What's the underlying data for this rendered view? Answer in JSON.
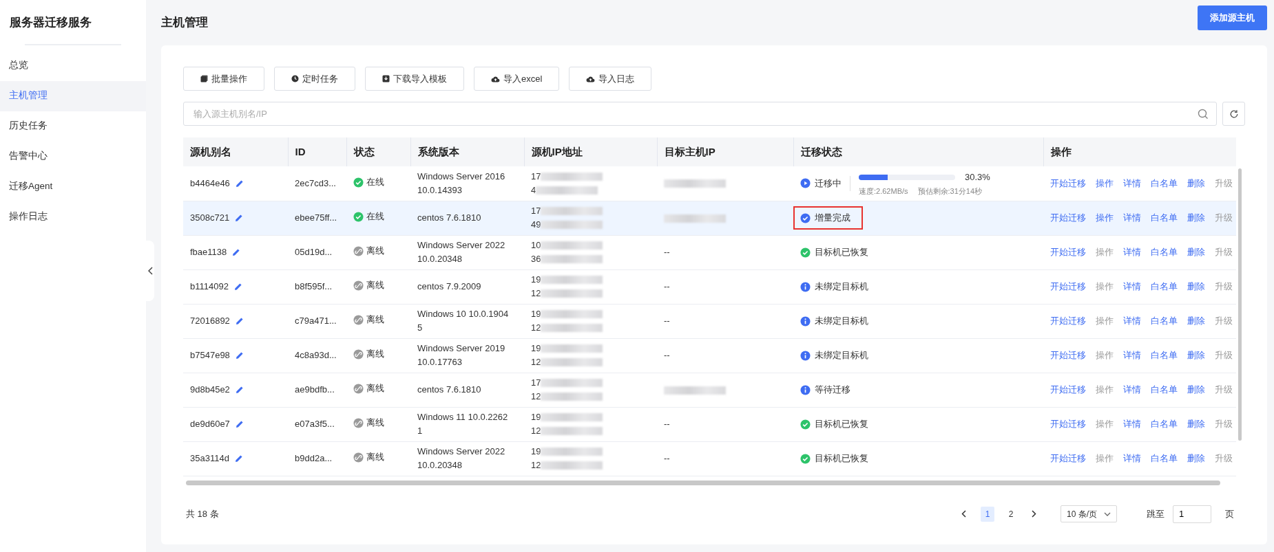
{
  "sidebar": {
    "title": "服务器迁移服务",
    "items": [
      {
        "label": "总览",
        "selected": false
      },
      {
        "label": "主机管理",
        "selected": true
      },
      {
        "label": "历史任务",
        "selected": false
      },
      {
        "label": "告警中心",
        "selected": false
      },
      {
        "label": "迁移Agent",
        "selected": false
      },
      {
        "label": "操作日志",
        "selected": false
      }
    ]
  },
  "header": {
    "title": "主机管理",
    "add_button": "添加源主机"
  },
  "toolbar": [
    {
      "label": "批量操作",
      "kind": "batch"
    },
    {
      "label": "定时任务",
      "kind": "schedule"
    },
    {
      "label": "下载导入模板",
      "kind": "download"
    },
    {
      "label": "导入excel",
      "kind": "import"
    },
    {
      "label": "导入日志",
      "kind": "import"
    }
  ],
  "search": {
    "placeholder": "输入源主机别名/IP"
  },
  "table": {
    "columns": [
      "源机别名",
      "ID",
      "状态",
      "系统版本",
      "源机IP地址",
      "目标主机IP",
      "迁移状态",
      "操作"
    ],
    "rows": [
      {
        "selected": false,
        "alias": "b4464e46",
        "id": "2ec7cd3...",
        "status": {
          "kind": "online",
          "label": "在线"
        },
        "os": [
          "Windows Server 2016",
          "10.0.14393"
        ],
        "source_ip": [
          "17",
          "4"
        ],
        "target_ip": {
          "kind": "redacted"
        },
        "migration": {
          "kind": "running",
          "label": "迁移中",
          "highlighted": false,
          "level": 0.303,
          "percent": "30.3%",
          "speed": "速度:2.62MB/s",
          "remaining": "预估剩余:31分14秒"
        },
        "actions": [
          {
            "label": "开始迁移",
            "disabled": false
          },
          {
            "label": "操作",
            "disabled": false
          },
          {
            "label": "详情",
            "disabled": false
          },
          {
            "label": "白名单",
            "disabled": false
          },
          {
            "label": "删除",
            "disabled": false
          },
          {
            "label": "升级",
            "disabled": true
          }
        ]
      },
      {
        "selected": true,
        "alias": "3508c721",
        "id": "ebee75ff...",
        "status": {
          "kind": "online",
          "label": "在线"
        },
        "os": [
          "centos 7.6.1810"
        ],
        "source_ip": [
          "17",
          "49"
        ],
        "target_ip": {
          "kind": "redacted"
        },
        "migration": {
          "kind": "completed",
          "label": "增量完成",
          "highlighted": true
        },
        "actions": [
          {
            "label": "开始迁移",
            "disabled": false
          },
          {
            "label": "操作",
            "disabled": false
          },
          {
            "label": "详情",
            "disabled": false
          },
          {
            "label": "白名单",
            "disabled": false
          },
          {
            "label": "删除",
            "disabled": false
          },
          {
            "label": "升级",
            "disabled": true
          }
        ]
      },
      {
        "selected": false,
        "alias": "fbae1138",
        "id": "05d19d...",
        "status": {
          "kind": "offline",
          "label": "离线"
        },
        "os": [
          "Windows Server 2022",
          "10.0.20348"
        ],
        "source_ip": [
          "10",
          "36"
        ],
        "target_ip": {
          "kind": "text",
          "text": "--"
        },
        "migration": {
          "kind": "restored",
          "label": "目标机已恢复",
          "highlighted": false
        },
        "actions": [
          {
            "label": "开始迁移",
            "disabled": false
          },
          {
            "label": "操作",
            "disabled": true
          },
          {
            "label": "详情",
            "disabled": false
          },
          {
            "label": "白名单",
            "disabled": false
          },
          {
            "label": "删除",
            "disabled": false
          },
          {
            "label": "升级",
            "disabled": true
          }
        ]
      },
      {
        "selected": false,
        "alias": "b1114092",
        "id": "b8f595f...",
        "status": {
          "kind": "offline",
          "label": "离线"
        },
        "os": [
          "centos 7.9.2009"
        ],
        "source_ip": [
          "19",
          "12"
        ],
        "target_ip": {
          "kind": "text",
          "text": "--"
        },
        "migration": {
          "kind": "pending",
          "label": "未绑定目标机",
          "highlighted": false
        },
        "actions": [
          {
            "label": "开始迁移",
            "disabled": false
          },
          {
            "label": "操作",
            "disabled": true
          },
          {
            "label": "详情",
            "disabled": false
          },
          {
            "label": "白名单",
            "disabled": false
          },
          {
            "label": "删除",
            "disabled": false
          },
          {
            "label": "升级",
            "disabled": true
          }
        ]
      },
      {
        "selected": false,
        "alias": "72016892",
        "id": "c79a471...",
        "status": {
          "kind": "offline",
          "label": "离线"
        },
        "os": [
          "Windows 10 10.0.1904",
          "5"
        ],
        "source_ip": [
          "19",
          "12"
        ],
        "target_ip": {
          "kind": "text",
          "text": "--"
        },
        "migration": {
          "kind": "pending",
          "label": "未绑定目标机",
          "highlighted": false
        },
        "actions": [
          {
            "label": "开始迁移",
            "disabled": false
          },
          {
            "label": "操作",
            "disabled": true
          },
          {
            "label": "详情",
            "disabled": false
          },
          {
            "label": "白名单",
            "disabled": false
          },
          {
            "label": "删除",
            "disabled": false
          },
          {
            "label": "升级",
            "disabled": true
          }
        ]
      },
      {
        "selected": false,
        "alias": "b7547e98",
        "id": "4c8a93d...",
        "status": {
          "kind": "offline",
          "label": "离线"
        },
        "os": [
          "Windows Server 2019",
          "10.0.17763"
        ],
        "source_ip": [
          "19",
          "12"
        ],
        "target_ip": {
          "kind": "text",
          "text": "--"
        },
        "migration": {
          "kind": "pending",
          "label": "未绑定目标机",
          "highlighted": false
        },
        "actions": [
          {
            "label": "开始迁移",
            "disabled": false
          },
          {
            "label": "操作",
            "disabled": true
          },
          {
            "label": "详情",
            "disabled": false
          },
          {
            "label": "白名单",
            "disabled": false
          },
          {
            "label": "删除",
            "disabled": false
          },
          {
            "label": "升级",
            "disabled": true
          }
        ]
      },
      {
        "selected": false,
        "alias": "9d8b45e2",
        "id": "ae9bdfb...",
        "status": {
          "kind": "offline",
          "label": "离线"
        },
        "os": [
          "centos 7.6.1810"
        ],
        "source_ip": [
          "17",
          "12"
        ],
        "target_ip": {
          "kind": "redacted"
        },
        "migration": {
          "kind": "pending",
          "label": "等待迁移",
          "highlighted": false
        },
        "actions": [
          {
            "label": "开始迁移",
            "disabled": false
          },
          {
            "label": "操作",
            "disabled": true
          },
          {
            "label": "详情",
            "disabled": false
          },
          {
            "label": "白名单",
            "disabled": false
          },
          {
            "label": "删除",
            "disabled": false
          },
          {
            "label": "升级",
            "disabled": true
          }
        ]
      },
      {
        "selected": false,
        "alias": "de9d60e7",
        "id": "e07a3f5...",
        "status": {
          "kind": "offline",
          "label": "离线"
        },
        "os": [
          "Windows 11 10.0.2262",
          "1"
        ],
        "source_ip": [
          "19",
          "12"
        ],
        "target_ip": {
          "kind": "text",
          "text": "--"
        },
        "migration": {
          "kind": "restored",
          "label": "目标机已恢复",
          "highlighted": false
        },
        "actions": [
          {
            "label": "开始迁移",
            "disabled": false
          },
          {
            "label": "操作",
            "disabled": true
          },
          {
            "label": "详情",
            "disabled": false
          },
          {
            "label": "白名单",
            "disabled": false
          },
          {
            "label": "删除",
            "disabled": false
          },
          {
            "label": "升级",
            "disabled": true
          }
        ]
      },
      {
        "selected": false,
        "alias": "35a3114d",
        "id": "b9dd2a...",
        "status": {
          "kind": "offline",
          "label": "离线"
        },
        "os": [
          "Windows Server 2022",
          "10.0.20348"
        ],
        "source_ip": [
          "19",
          "12"
        ],
        "target_ip": {
          "kind": "text",
          "text": "--"
        },
        "migration": {
          "kind": "restored",
          "label": "目标机已恢复",
          "highlighted": false
        },
        "actions": [
          {
            "label": "开始迁移",
            "disabled": false
          },
          {
            "label": "操作",
            "disabled": true
          },
          {
            "label": "详情",
            "disabled": false
          },
          {
            "label": "白名单",
            "disabled": false
          },
          {
            "label": "删除",
            "disabled": false
          },
          {
            "label": "升级",
            "disabled": true
          }
        ]
      }
    ]
  },
  "pagination": {
    "total": "共 18 条",
    "pages": [
      {
        "label": "1",
        "selected": true
      },
      {
        "label": "2",
        "selected": false
      }
    ],
    "page_size": "10 条/页",
    "jump_label": "跳至",
    "jump_value": "1",
    "page_unit": "页"
  }
}
